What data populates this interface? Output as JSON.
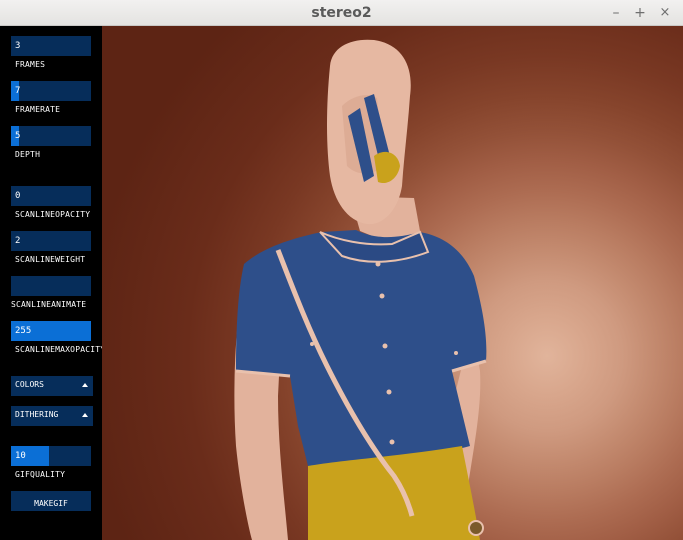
{
  "window": {
    "title": "stereo2",
    "min": "–",
    "max": "+",
    "close": "×"
  },
  "controls": {
    "frames": {
      "value": "3",
      "label": "FRAMES",
      "fraction": 0.0
    },
    "framerate": {
      "value": "7",
      "label": "FRAMERATE",
      "fraction": 0.1
    },
    "depth": {
      "value": "5",
      "label": "DEPTH",
      "fraction": 0.1
    },
    "scanlineopacity": {
      "value": "0",
      "label": "SCANLINEOPACITY",
      "fraction": 0.0
    },
    "scanlineweight": {
      "value": "2",
      "label": "SCANLINEWEIGHT",
      "fraction": 0.0
    },
    "scanlineanimate": {
      "value": "",
      "label": "SCANLINEANIMATE",
      "fraction": 0.0
    },
    "scanlinemaxopacity": {
      "value": "255",
      "label": "SCANLINEMAXOPACITY",
      "fraction": 1.0
    },
    "colors": {
      "value": "COLORS"
    },
    "dithering": {
      "value": "DITHERING"
    },
    "gifquality": {
      "value": "10",
      "label": "GIFQUALITY",
      "fraction": 0.47
    },
    "makegif": {
      "label": "MAKEGIF"
    }
  },
  "colors": {
    "field_bg": "#062d5a",
    "field_fill": "#0b6fd6",
    "shirt": "#2e4f8a",
    "skin": "#e2b29c",
    "skirt": "#c9a21c",
    "background_dark": "#5d2414"
  }
}
